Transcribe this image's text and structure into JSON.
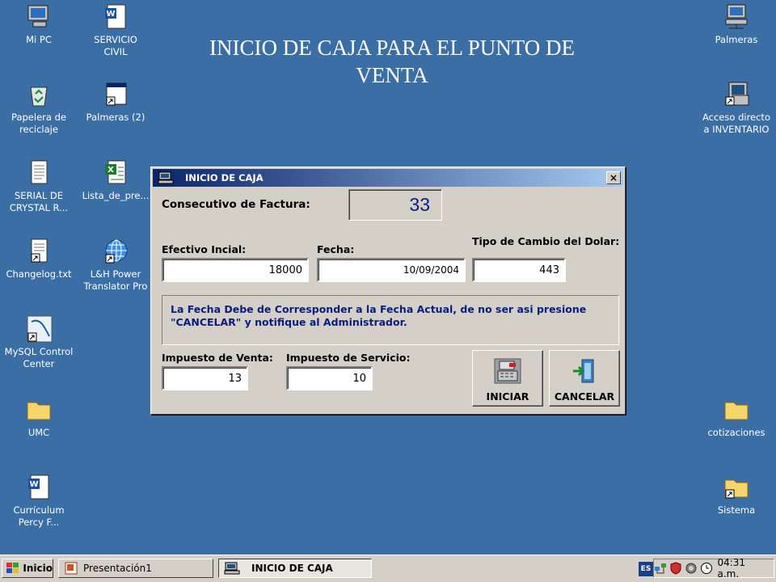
{
  "slide": {
    "title": "INICIO DE CAJA PARA EL PUNTO DE VENTA"
  },
  "desktop_left": [
    {
      "label": "Mi PC",
      "icon": "computer-icon"
    },
    {
      "label": "SERVICIO\nCIVIL",
      "icon": "word-document-icon"
    },
    {
      "label": "Papelera de\nreciclaje",
      "icon": "recycle-bin-icon"
    },
    {
      "label": "Palmeras (2)",
      "icon": "shortcut-window-icon"
    },
    {
      "label": "SERIAL DE\nCRYSTAL R...",
      "icon": "text-file-icon"
    },
    {
      "label": "Lista_de_pre...",
      "icon": "excel-file-icon"
    },
    {
      "label": "Changelog.txt",
      "icon": "text-file-icon"
    },
    {
      "label": "L&H Power\nTranslator Pro",
      "icon": "globe-icon"
    },
    {
      "label": "MySQL Control\nCenter",
      "icon": "mysql-icon"
    },
    {
      "label": "UMC",
      "icon": "folder-icon"
    },
    {
      "label": "Currículum\nPercy F...",
      "icon": "word-document-icon"
    }
  ],
  "desktop_right": [
    {
      "label": "Palmeras",
      "icon": "network-computer-icon"
    },
    {
      "label": "Acceso directo\na INVENTARIO",
      "icon": "shortcut-app-icon"
    },
    {
      "label": "cotizaciones",
      "icon": "folder-icon"
    },
    {
      "label": "Sistema",
      "icon": "folder-shortcut-icon"
    }
  ],
  "dialog": {
    "title": "INICIO DE CAJA",
    "close": "×",
    "consecutivo_label": "Consecutivo de Factura:",
    "consecutivo_value": "33",
    "efectivo_label": "Efectivo Incial:",
    "efectivo_value": "18000",
    "fecha_label": "Fecha:",
    "fecha_value": "10/09/2004",
    "cambio_label": "Tipo de Cambio del Dolar:",
    "cambio_value": "443",
    "notice_line1": "La Fecha Debe de Corresponder a la Fecha Actual, de no ser asi presione",
    "notice_line2": "\"CANCELAR\" y notifique al Administrador.",
    "venta_label": "Impuesto de Venta:",
    "venta_value": "13",
    "servicio_label": "Impuesto de Servicio:",
    "servicio_value": "10",
    "iniciar_label": "INICIAR",
    "cancelar_label": "CANCELAR"
  },
  "taskbar": {
    "start": "Inicio",
    "task1": "Presentación1",
    "task2": "INICIO DE CAJA",
    "lang": "ES",
    "clock": "04:31 a.m."
  }
}
